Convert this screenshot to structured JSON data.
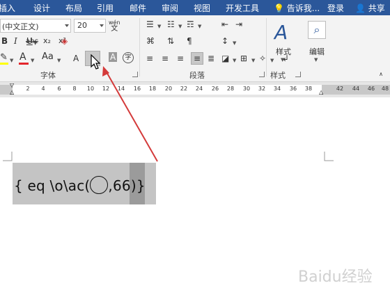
{
  "menu": {
    "tabs": [
      "插入",
      "设计",
      "布局",
      "引用",
      "邮件",
      "审阅",
      "视图",
      "开发工具"
    ],
    "tell_me": "告诉我...",
    "login": "登录",
    "share": "共享"
  },
  "ribbon": {
    "font_name": "(中文正文)",
    "font_size": "20",
    "font_group_label": "字体",
    "paragraph_group_label": "段落",
    "style_group_label": "样式",
    "style_button_label": "样式",
    "edit_button_label": "编辑",
    "bold": "B",
    "italic": "I",
    "underline": "U",
    "strikethrough": "abc",
    "subscript": "x₂",
    "superscript": "x²",
    "font_color_glyph": "A",
    "change_case": "Aa",
    "grow_font": "A",
    "char_shading": "A",
    "enclose_char": "字",
    "pinyin_top": "wén",
    "pinyin_bottom": "文"
  },
  "ruler": {
    "ticks": [
      "2",
      "4",
      "6",
      "8",
      "10",
      "12",
      "14",
      "16",
      "18",
      "20",
      "22",
      "24",
      "26",
      "28",
      "30",
      "32",
      "34",
      "36",
      "38",
      "42",
      "44",
      "46",
      "48"
    ]
  },
  "document": {
    "field_text_before": "{  eq \\o\\ac(",
    "field_text_after": ",66)}"
  },
  "watermark": "Baidu经验",
  "colors": {
    "tab_bar": "#2b579a",
    "font_color_underline": "#e3262b",
    "highlight_underline": "#ffff00",
    "arrow": "#d43a3a"
  }
}
